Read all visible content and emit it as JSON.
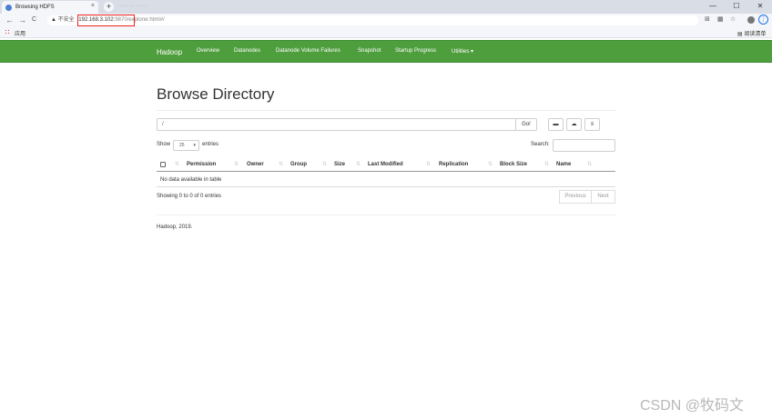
{
  "browser": {
    "tab_title": "Browsing HDFS",
    "tab_close": "×",
    "new_tab": "+",
    "insecure_label": "不安全",
    "url_host": "192.168.3.102:",
    "url_port": "9870",
    "url_path": "/explorer.html#/",
    "bookmarks_apps": "应用",
    "reading_list": "阅读清单",
    "window_controls": [
      "—",
      "☐",
      "✕"
    ],
    "nav": {
      "back": "←",
      "forward": "→",
      "reload": "C"
    }
  },
  "navbar": {
    "brand": "Hadoop",
    "links": [
      "Overview",
      "Datanodes",
      "Datanode Volume Failures",
      "Snapshot",
      "Startup Progress",
      "Utilities ▾"
    ]
  },
  "page": {
    "title": "Browse Directory",
    "path_value": "/",
    "go_label": "Go!",
    "icon_buttons": [
      "folder-icon",
      "upload-icon",
      "list-icon"
    ]
  },
  "table_controls": {
    "show_label": "Show",
    "entries_value": "25",
    "entries_label": "entries",
    "search_label": "Search:"
  },
  "table": {
    "columns": [
      "Permission",
      "Owner",
      "Group",
      "Size",
      "Last Modified",
      "Replication",
      "Block Size",
      "Name"
    ],
    "empty_text": "No data available in table"
  },
  "pagination": {
    "info": "Showing 0 to 0 of 0 entries",
    "previous": "Previous",
    "next": "Next"
  },
  "footer": "Hadoop, 2019.",
  "watermark": "CSDN @牧码文",
  "colors": {
    "navbar": "#4f9e3e",
    "url_highlight": "#e22222"
  }
}
